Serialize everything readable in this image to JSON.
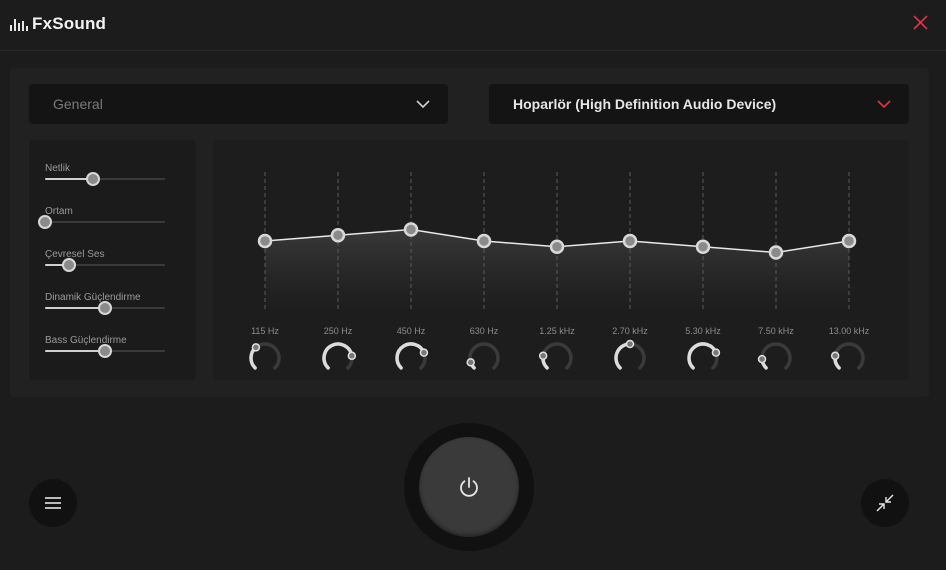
{
  "app": {
    "name": "FxSound"
  },
  "preset": {
    "value": "General"
  },
  "device": {
    "value": "Hoparlör (High Definition Audio Device)"
  },
  "effects": [
    {
      "label": "Netlik",
      "value": 0.4
    },
    {
      "label": "Ortam",
      "value": 0.0
    },
    {
      "label": "Çevresel Ses",
      "value": 0.2
    },
    {
      "label": "Dinamik Güçlendirme",
      "value": 0.5
    },
    {
      "label": "Bass Güçlendirme",
      "value": 0.5
    }
  ],
  "equalizer": {
    "bands": [
      {
        "freq": "115 Hz",
        "gain": 0.0,
        "knob": 0.35
      },
      {
        "freq": "250 Hz",
        "gain": 0.8,
        "knob": 0.8
      },
      {
        "freq": "450 Hz",
        "gain": 1.6,
        "knob": 0.75
      },
      {
        "freq": "630 Hz",
        "gain": 0.0,
        "knob": 0.1
      },
      {
        "freq": "1.25 kHz",
        "gain": -0.8,
        "knob": 0.2
      },
      {
        "freq": "2.70 kHz",
        "gain": 0.0,
        "knob": 0.5
      },
      {
        "freq": "5.30 kHz",
        "gain": -0.8,
        "knob": 0.75
      },
      {
        "freq": "7.50 kHz",
        "gain": -1.6,
        "knob": 0.15
      },
      {
        "freq": "13.00 kHz",
        "gain": 0.0,
        "knob": 0.2
      }
    ]
  },
  "colors": {
    "accent": "#e0344a",
    "background": "#1c1c1c"
  },
  "icons": {
    "close": "close-icon",
    "menu": "hamburger-menu-icon",
    "power": "power-icon",
    "minimize": "collapse-arrows-icon"
  }
}
